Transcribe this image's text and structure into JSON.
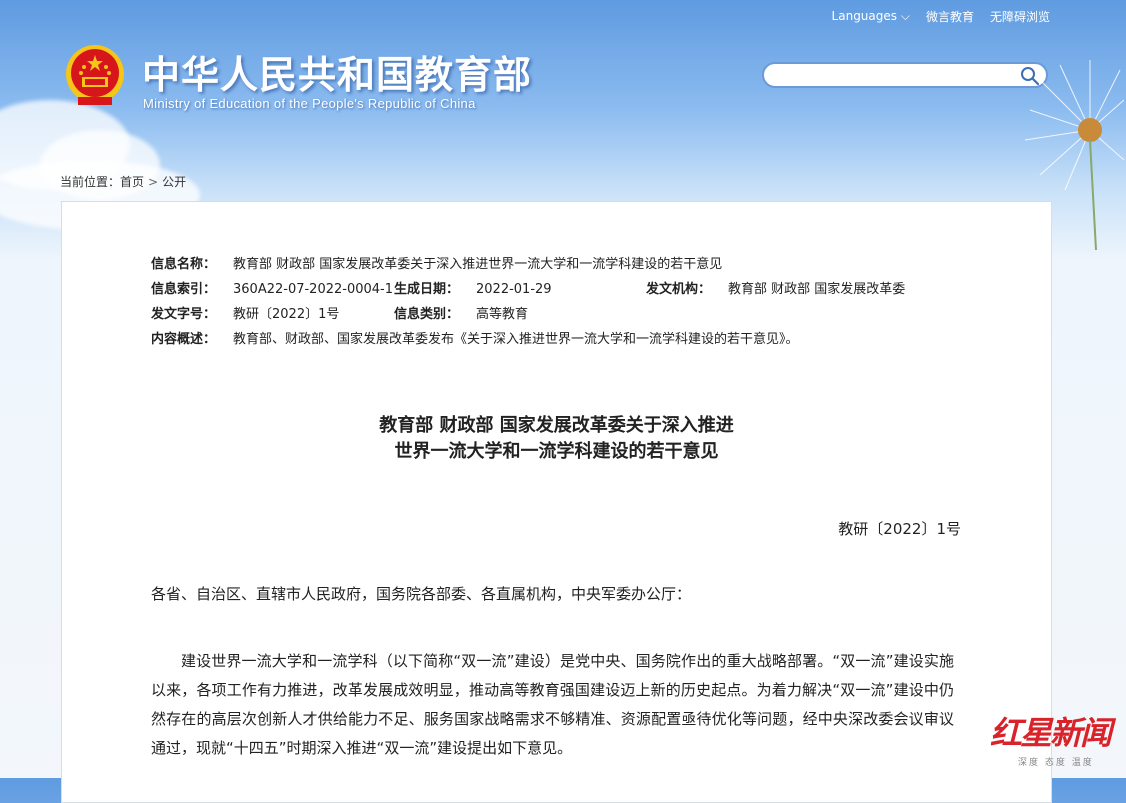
{
  "header": {
    "languages_label": "Languages",
    "weiyan_label": "微言教育",
    "accessibility_label": "无障碍浏览",
    "site_title": "中华人民共和国教育部",
    "site_subtitle": "Ministry of Education of the People's Republic of China",
    "search_placeholder": ""
  },
  "breadcrumb": {
    "prefix": "当前位置：",
    "home": "首页",
    "current": "公开"
  },
  "meta": {
    "name_label": "信息名称：",
    "name_value": "教育部 财政部 国家发展改革委关于深入推进世界一流大学和一流学科建设的若干意见",
    "index_label": "信息索引：",
    "index_value": "360A22-07-2022-0004-1",
    "date_label": "生成日期：",
    "date_value": "2022-01-29",
    "org_label": "发文机构：",
    "org_value": "教育部 财政部 国家发展改革委",
    "docnum_label": "发文字号：",
    "docnum_value": "教研〔2022〕1号",
    "category_label": "信息类别：",
    "category_value": "高等教育",
    "summary_label": "内容概述：",
    "summary_value": "教育部、财政部、国家发展改革委发布《关于深入推进世界一流大学和一流学科建设的若干意见》。"
  },
  "document": {
    "title_line1": "教育部 财政部 国家发展改革委关于深入推进",
    "title_line2": "世界一流大学和一流学科建设的若干意见",
    "doc_number": "教研〔2022〕1号",
    "addressee": "各省、自治区、直辖市人民政府，国务院各部委、各直属机构，中央军委办公厅：",
    "paragraph1": "建设世界一流大学和一流学科（以下简称“双一流”建设）是党中央、国务院作出的重大战略部署。“双一流”建设实施以来，各项工作有力推进，改革发展成效明显，推动高等教育强国建设迈上新的历史起点。为着力解决“双一流”建设中仍然存在的高层次创新人才供给能力不足、服务国家战略需求不够精准、资源配置亟待优化等问题，经中央深改委会议审议通过，现就“十四五”时期深入推进“双一流”建设提出如下意见。"
  },
  "watermark": {
    "main": "红星新闻",
    "sub": "深度 态度 温度"
  },
  "colors": {
    "sky_top": "#5f9be0",
    "emblem_red": "#d7161c",
    "emblem_gold": "#f5c518",
    "watermark_red": "#d9222a"
  }
}
